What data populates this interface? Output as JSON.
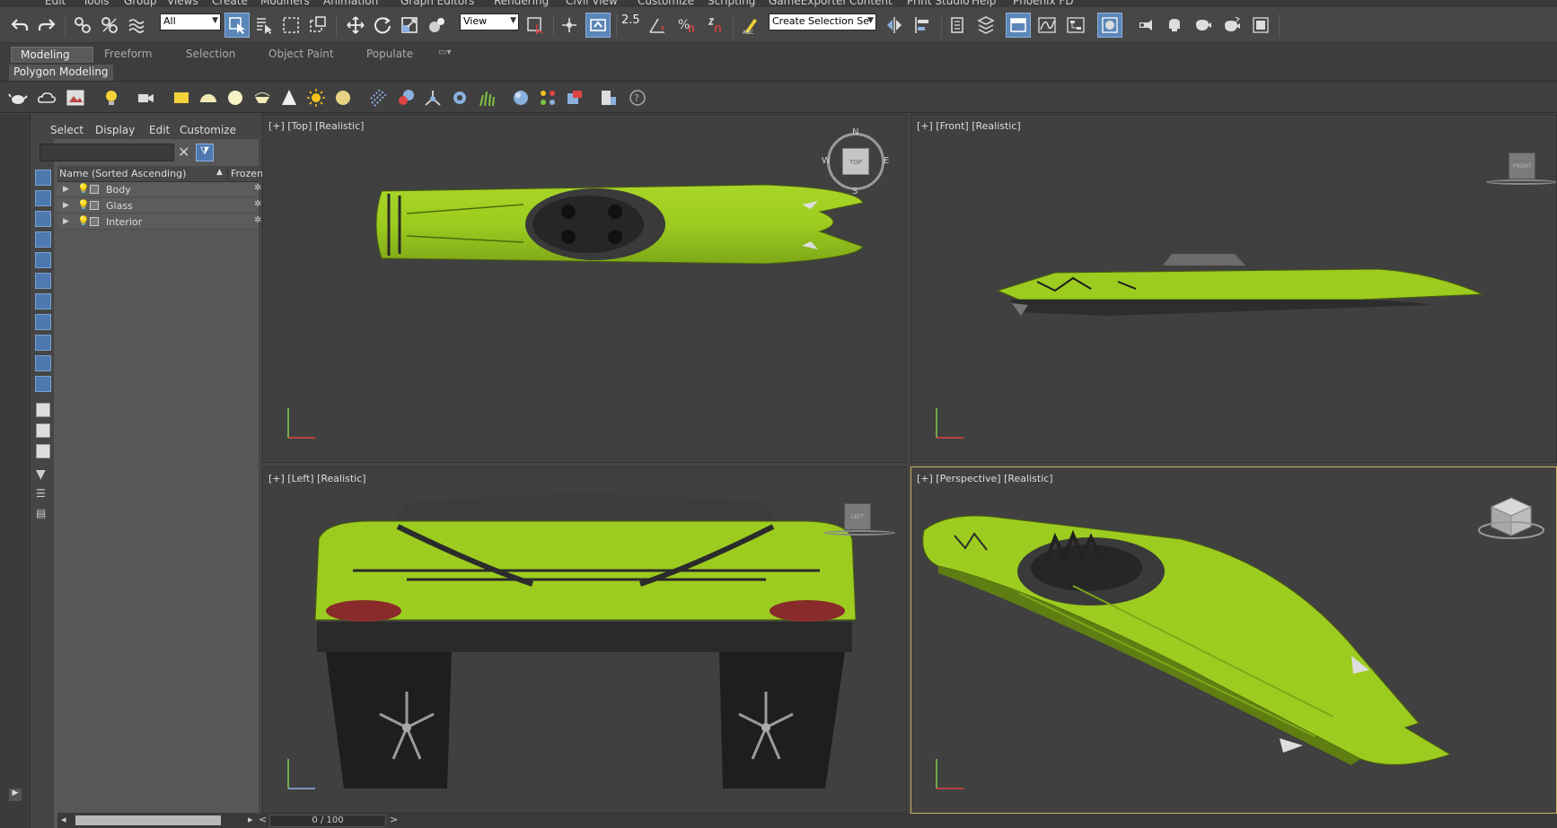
{
  "menu": [
    "Edit",
    "Tools",
    "Group",
    "Views",
    "Create",
    "Modifiers",
    "Animation",
    "Graph Editors",
    "Rendering",
    "Civil View",
    "Customize",
    "Scripting",
    "GameExporter",
    "Content",
    "Print Studio",
    "Help",
    "Phoenix FD"
  ],
  "toolbar": {
    "selection_filter": "All",
    "reference_coord": "View",
    "snap_value": "2.5",
    "named_selection_placeholder": "Create Selection Se"
  },
  "ribbon": {
    "tabs": [
      "Modeling",
      "Freeform",
      "Selection",
      "Object Paint",
      "Populate"
    ],
    "active_panel": "Polygon Modeling"
  },
  "explorer": {
    "menu": [
      "Select",
      "Display",
      "Edit",
      "Customize"
    ],
    "col_name": "Name (Sorted Ascending)",
    "col_frozen": "Frozen",
    "rows": [
      "Body",
      "Glass",
      "Interior"
    ]
  },
  "viewports": {
    "top": {
      "label": "[+] [Top] [Realistic]",
      "cube": "TOP",
      "compass": [
        "N",
        "E",
        "S",
        "W"
      ]
    },
    "front": {
      "label": "[+] [Front] [Realistic]",
      "cube": "FRONT"
    },
    "left": {
      "label": "[+] [Left] [Realistic]",
      "cube": "LEFT"
    },
    "persp": {
      "label": "[+] [Perspective] [Realistic]"
    }
  },
  "timeline": {
    "frame": "0 / 100",
    "prev": "<",
    "next": ">"
  },
  "colors": {
    "boat": "#9ccc1f",
    "boat_dark": "#6f9614",
    "active_border": "#c9b35e",
    "accent": "#4d79b0"
  }
}
